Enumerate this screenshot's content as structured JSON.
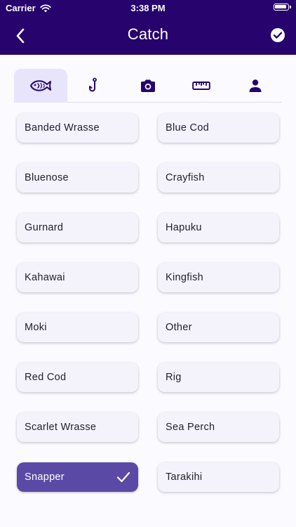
{
  "status_bar": {
    "carrier": "Carrier",
    "time": "3:38 PM"
  },
  "header": {
    "title": "Catch",
    "back_icon": "chevron-left-icon",
    "confirm_icon": "check-circle-icon"
  },
  "tabs": [
    {
      "icon": "fish-icon",
      "active": true
    },
    {
      "icon": "hook-icon",
      "active": false
    },
    {
      "icon": "camera-icon",
      "active": false
    },
    {
      "icon": "ruler-icon",
      "active": false
    },
    {
      "icon": "person-icon",
      "active": false
    }
  ],
  "species": [
    {
      "name": "Banded Wrasse",
      "selected": false
    },
    {
      "name": "Blue Cod",
      "selected": false
    },
    {
      "name": "Bluenose",
      "selected": false
    },
    {
      "name": "Crayfish",
      "selected": false
    },
    {
      "name": "Gurnard",
      "selected": false
    },
    {
      "name": "Hapuku",
      "selected": false
    },
    {
      "name": "Kahawai",
      "selected": false
    },
    {
      "name": "Kingfish",
      "selected": false
    },
    {
      "name": "Moki",
      "selected": false
    },
    {
      "name": "Other",
      "selected": false
    },
    {
      "name": "Red Cod",
      "selected": false
    },
    {
      "name": "Rig",
      "selected": false
    },
    {
      "name": "Scarlet Wrasse",
      "selected": false
    },
    {
      "name": "Sea Perch",
      "selected": false
    },
    {
      "name": "Snapper",
      "selected": true
    },
    {
      "name": "Tarakihi",
      "selected": false
    }
  ],
  "colors": {
    "header_bg": "#27036d",
    "selected_bg": "#5a4aa6",
    "active_tab_bg": "#e8e4fb",
    "icon_dark": "#27036d"
  }
}
